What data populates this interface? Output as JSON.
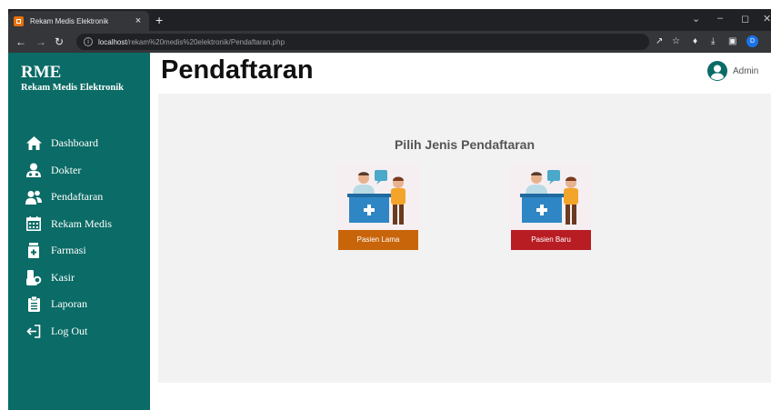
{
  "browser": {
    "tab_title": "Rekam Medis Elektronik",
    "tab_close": "×",
    "new_tab": "+",
    "url_host": "localhost",
    "url_path": "/rekam%20medis%20elektronik/Pendaftaran.php",
    "profile_initial": "D"
  },
  "sidebar": {
    "brand_title": "RME",
    "brand_subtitle": "Rekam Medis Elektronik",
    "items": [
      {
        "label": "Dashboard",
        "icon": "home-icon"
      },
      {
        "label": "Dokter",
        "icon": "doctor-icon"
      },
      {
        "label": "Pendaftaran",
        "icon": "users-icon"
      },
      {
        "label": "Rekam Medis",
        "icon": "calendar-icon"
      },
      {
        "label": "Farmasi",
        "icon": "medicine-bottle-icon"
      },
      {
        "label": "Kasir",
        "icon": "cash-hand-icon"
      },
      {
        "label": "Laporan",
        "icon": "clipboard-icon"
      },
      {
        "label": "Log Out",
        "icon": "logout-icon"
      }
    ]
  },
  "header": {
    "title": "Pendaftaran",
    "user_name": "Admin"
  },
  "main": {
    "heading": "Pilih Jenis Pendaftaran",
    "cards": [
      {
        "button_label": "Pasien Lama",
        "button_color": "#c8650b"
      },
      {
        "button_label": "Pasien Baru",
        "button_color": "#b81d24"
      }
    ]
  },
  "colors": {
    "sidebar": "#0b6b66",
    "content_bg": "#f3f2f3"
  }
}
